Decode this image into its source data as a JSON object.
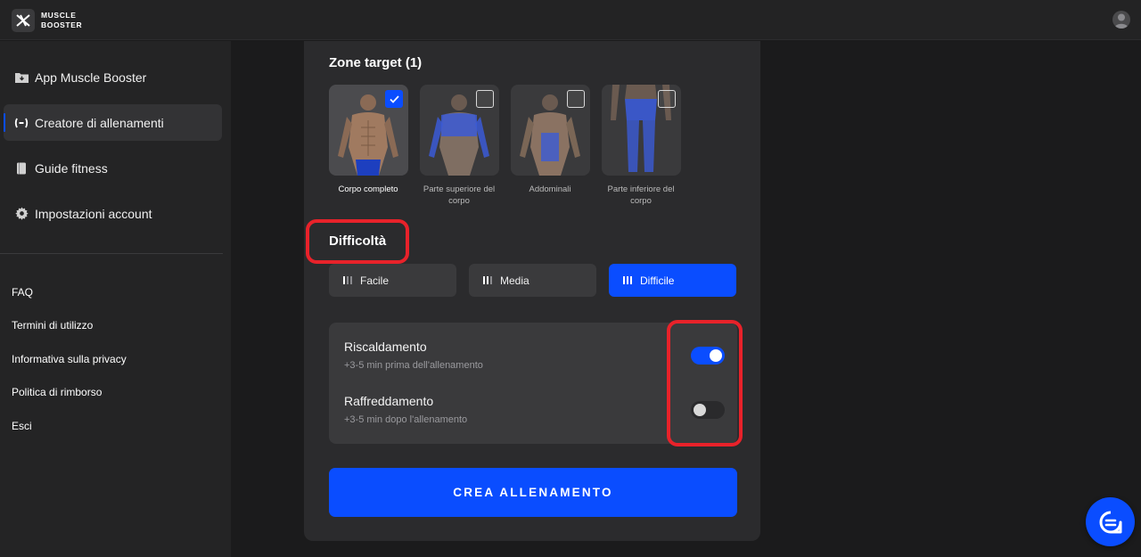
{
  "brand": {
    "line1": "MUSCLE",
    "line2": "BOOSTER"
  },
  "sidebar": {
    "items": [
      {
        "label": "App Muscle Booster",
        "icon": "folder-download-icon"
      },
      {
        "label": "Creatore di allenamenti",
        "icon": "workout-builder-icon",
        "active": true
      },
      {
        "label": "Guide fitness",
        "icon": "book-icon"
      },
      {
        "label": "Impostazioni account",
        "icon": "gear-icon"
      }
    ],
    "links": [
      "FAQ",
      "Termini di utilizzo",
      "Informativa sulla privacy",
      "Politica di rimborso",
      "Esci"
    ]
  },
  "zones": {
    "title": "Zone target (1)",
    "items": [
      {
        "label": "Corpo completo",
        "selected": true
      },
      {
        "label": "Parte superiore del corpo",
        "selected": false
      },
      {
        "label": "Addominali",
        "selected": false
      },
      {
        "label": "Parte inferiore del corpo",
        "selected": false
      }
    ]
  },
  "difficulty": {
    "title": "Difficoltà",
    "options": [
      {
        "label": "Facile",
        "selected": false
      },
      {
        "label": "Media",
        "selected": false
      },
      {
        "label": "Difficile",
        "selected": true
      }
    ]
  },
  "toggles": [
    {
      "title": "Riscaldamento",
      "subtitle": "+3-5 min prima dell'allenamento",
      "on": true
    },
    {
      "title": "Raffreddamento",
      "subtitle": "+3-5 min dopo l'allenamento",
      "on": false
    }
  ],
  "cta": {
    "label": "CREA ALLENAMENTO"
  },
  "colors": {
    "accent": "#0a4dff",
    "highlight": "#e8222a",
    "background": "#1b1b1c",
    "card": "#2b2b2d"
  }
}
